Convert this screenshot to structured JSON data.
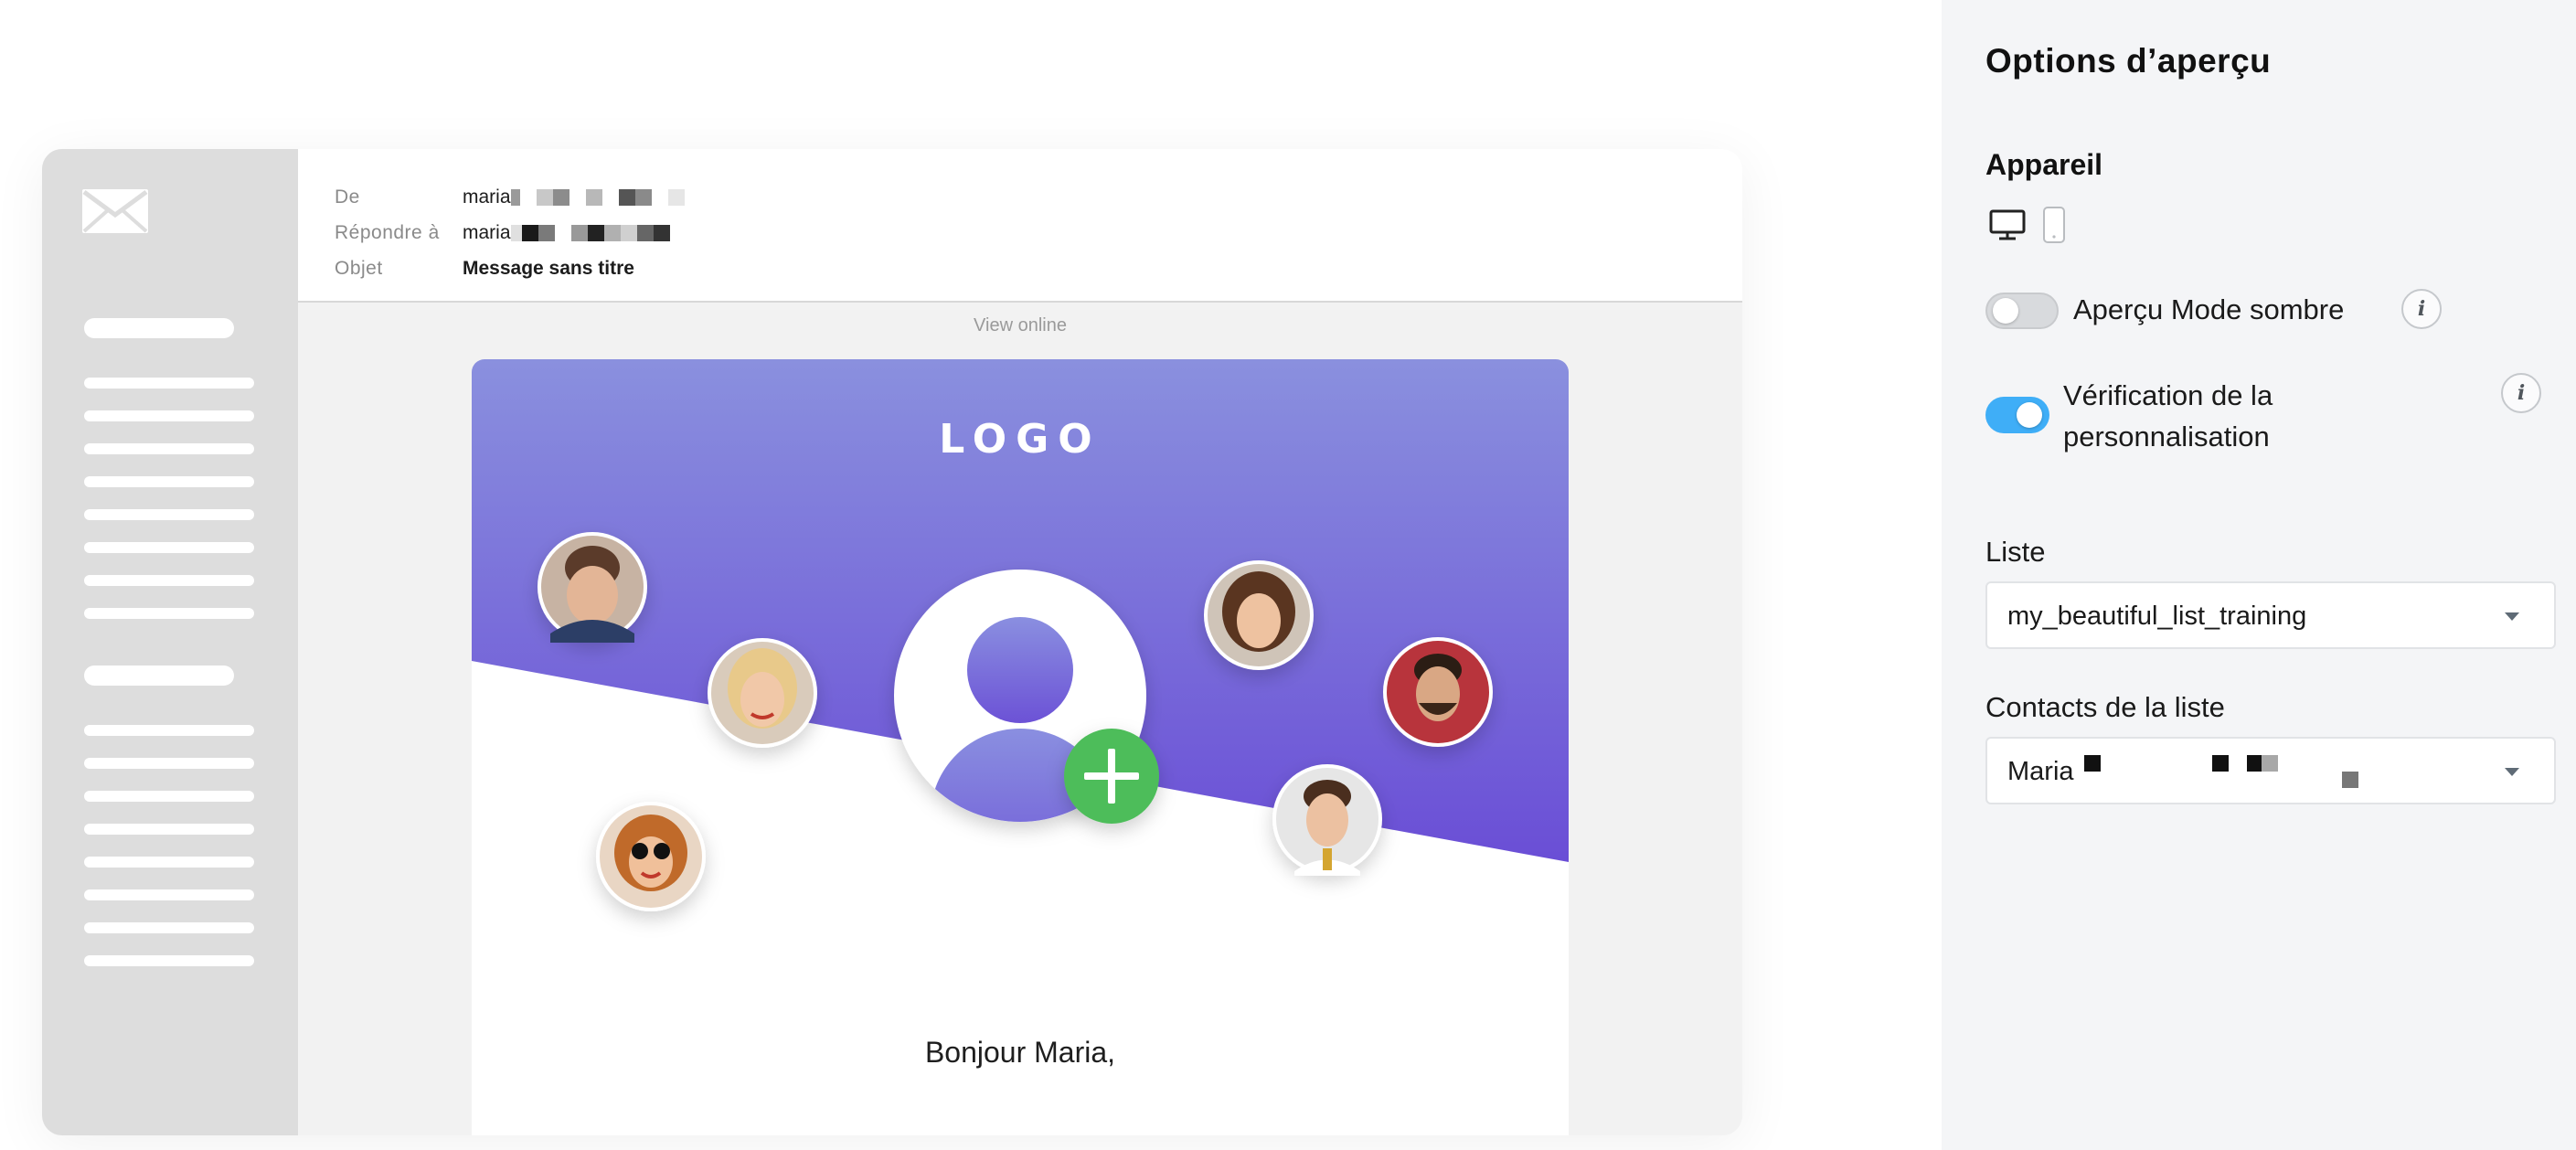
{
  "email_header": {
    "from_label": "De",
    "from_value": "maria",
    "reply_to_label": "Répondre à",
    "reply_to_value": "maria",
    "subject_label": "Objet",
    "subject_value": "Message sans titre"
  },
  "email_body": {
    "view_online": "View online",
    "logo": "LOGO",
    "greeting": "Bonjour Maria,"
  },
  "options": {
    "title": "Options d’aperçu",
    "device_section": "Appareil",
    "devices": [
      "desktop-icon",
      "mobile-icon"
    ],
    "selected_device": "desktop",
    "dark_mode_label": "Aperçu Mode sombre",
    "dark_mode_enabled": false,
    "personalization_label_line1": "Vérification de la",
    "personalization_label_line2": "personnalisation",
    "personalization_enabled": true,
    "list_label": "Liste",
    "list_value": "my_beautiful_list_training",
    "contacts_label": "Contacts de la liste",
    "contact_value": "Maria"
  },
  "colors": {
    "toggle_on": "#3faef7",
    "banner_gradient_top": "#8a90de",
    "banner_gradient_bottom": "#6a4ed6",
    "add_button": "#4dbd5a",
    "panel_background": "#f4f5f7"
  }
}
